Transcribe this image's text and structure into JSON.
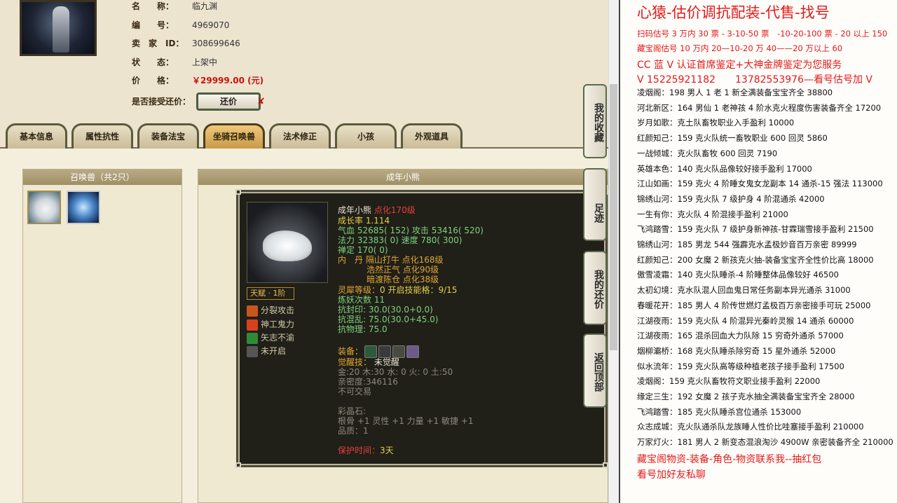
{
  "basic": {
    "name_key": "名　　称：",
    "name_val": "临九渊",
    "id_key": "编　　号：",
    "id_val": "4969070",
    "seller_key": "卖　家　ID：",
    "seller_val": "308699646",
    "status_key": "状　　态：",
    "status_val": "上架中",
    "price_key": "价　　格：",
    "price_val": "￥29999.00 (元)",
    "counter_key": "是否接受还价：",
    "counter_btn": "还价",
    "counter_x": "✘"
  },
  "tabs": [
    "基本信息",
    "属性抗性",
    "装备法宝",
    "坐骑召唤兽",
    "法术修正",
    "小孩",
    "外观道具"
  ],
  "pet_list": {
    "title": "召唤兽（共2只）"
  },
  "detail": {
    "header": "成年小熊",
    "talent": "天赋 · 1阶",
    "skills": [
      "分裂攻击",
      "神工鬼力",
      "矢志不渝",
      "未开启"
    ],
    "name": "成年小熊",
    "name_tag": "点化170级",
    "growth": "成长率 1.114",
    "hp": "气血 52685( 152) 攻击 53416( 520)",
    "mp": "法力 32383( 0) 速度 780( 300)",
    "zen": "禅定 170( 0)",
    "neidan1": "内　丹 隔山打牛 点化168级",
    "neidan2": "浩然正气 点化90级",
    "neidan3": "暗渡陈仓 点化38级",
    "ling_a": "灵犀等级：",
    "ling_b": "0 开启技能格：9/15",
    "lianyao": "炼妖次数 11",
    "r1": "抗封印: 30.0(30.0+0.0)",
    "r2": "抗混乱: 75.0(30.0+45.0)",
    "r3": "抗物理: 75.0",
    "equip": "装备：",
    "awaken_a": "觉醒技：",
    "awaken_b": "未觉醒",
    "elements": "金:20 木:30 水: 0 火: 0 土:50",
    "intimacy": "亲密度:346116",
    "trade": "不可交易",
    "gem_title": "彩晶石:",
    "gem1": "根骨 +1 灵性 +1 力量 +1 敏捷 +1",
    "gem2": "品质：1",
    "protect_a": "保护时间：",
    "protect_b": "3天"
  },
  "side_buttons": [
    {
      "label": "我的收藏"
    },
    {
      "label": "足迹"
    },
    {
      "label": "我的还价"
    },
    {
      "label": "返回顶部"
    }
  ],
  "panel": {
    "title": "心猿-估价调抗配装-代售-找号",
    "lines": [
      {
        "text": "扫码估号 3 万内 30 票 - 3-10-50 票　-10-20-100 票 - 20 以上 150",
        "red": true
      },
      {
        "text": "藏宝阁估号 10 万内 20—10-20 万 40——20 万以上 60",
        "red": true
      },
      {
        "text": "CC 蓝 V 认证首席鉴定+大神金牌鉴定为您服务",
        "red": true,
        "big": true
      },
      {
        "text": "V 15225921182　　13782553976—看号估号加 V",
        "red": true,
        "big": true
      },
      {
        "text": "凌烟阁：198 男人 1 老 1 新全满装备宝宝齐全 38800",
        "red": false
      },
      {
        "text": "河北新区：164 男仙 1 老神孩 4 阶水克火程度伤害装备齐全 17200",
        "red": false
      },
      {
        "text": "岁月如歌：克土队畜牧职业入手盈利 10000",
        "red": false
      },
      {
        "text": "红颜知己：159 克火队统一畜牧职业 600 回灵 5860",
        "red": false
      },
      {
        "text": "一战倾城：克火队畜牧 600 回灵 7190",
        "red": false
      },
      {
        "text": "英雄本色：140 克火队品像较好接手盈利 17000",
        "red": false
      },
      {
        "text": "江山如画：159 克火 4 阶睡女鬼女龙副本 14 通杀-15 强法 113000",
        "red": false
      },
      {
        "text": "锦绣山河：159 克火队 7 级护身 4 阶混通杀 42000",
        "red": false
      },
      {
        "text": "一生有你：克火队 4 阶混接手盈利 21000",
        "red": false
      },
      {
        "text": "飞鸿踏雪：159 克火队 7 级护身新神孩-甘霖瑞雪接手盈利 21500",
        "red": false
      },
      {
        "text": "锦绣山河：185 男龙 544 强霹克水孟极妙音百万亲密 89999",
        "red": false
      },
      {
        "text": "红颜知己：200 女魔 2 新孩克火抽-装备宝宝齐全性价比高 18000",
        "red": false
      },
      {
        "text": "傲雪凌霜：140 克火队睡杀-4 阶睡整体品像较好 46500",
        "red": false
      },
      {
        "text": "太初幻境：克水队混人回血鬼日常任务副本异光通杀 31000",
        "red": false
      },
      {
        "text": "春暖花开：185 男人 4 阶传世燃灯孟极百万亲密接手可玩 25000",
        "red": false
      },
      {
        "text": "江湖夜雨：159 克火队 4 阶混异光秦岭灵猴 14 通杀 60000",
        "red": false
      },
      {
        "text": "江湖夜雨：165 混杀回血大力队除 15 穷奇外通杀 57000",
        "red": false
      },
      {
        "text": "烟柳灞桥：168 克火队睡杀除穷奇 15 星外通杀 52000",
        "red": false
      },
      {
        "text": "似水流年：159 克火队高等级种植老孩子接手盈利 17500",
        "red": false
      },
      {
        "text": "凌烟阁：159 克火队畜牧符文职业接手盈利 22000",
        "red": false
      },
      {
        "text": "缘定三生：192 女魔 2 孩子克水抽全满装备宝宝齐全 28000",
        "red": false
      },
      {
        "text": "飞鸿踏雪：185 克火队睡杀宫位通杀 153000",
        "red": false
      },
      {
        "text": "众志成城：克火队通杀队龙族睡人性价比哇塞接手盈利 210000",
        "red": false
      },
      {
        "text": "万家灯火：181 男人 2 新变态混浪淘沙 4900W 亲密装备齐全 210000",
        "red": false
      },
      {
        "text": "藏宝阁物资-装备-角色-物资联系我--抽红包",
        "red": true,
        "big": true
      },
      {
        "text": "看号加好友私聊",
        "red": true,
        "big": true
      }
    ]
  }
}
